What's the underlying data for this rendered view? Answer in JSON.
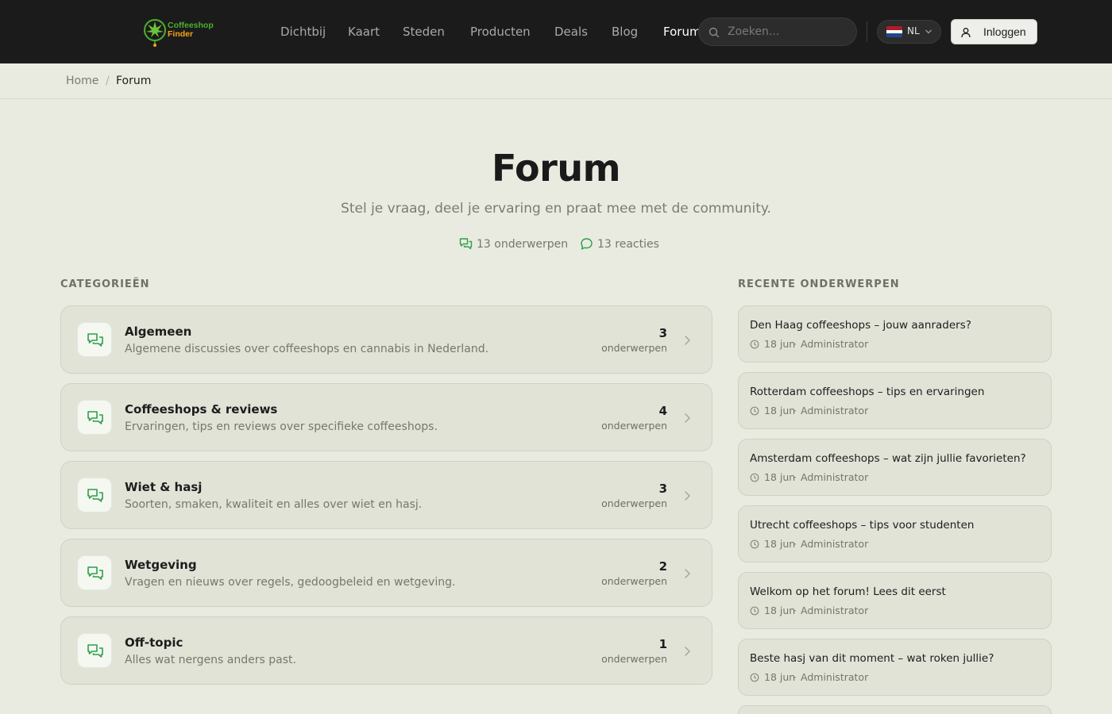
{
  "brand": {
    "line1": "Coffeeshop",
    "line2": "Finder"
  },
  "nav": [
    {
      "label": "Dichtbij",
      "active": false
    },
    {
      "label": "Kaart",
      "active": false
    },
    {
      "label": "Steden",
      "active": false
    },
    {
      "label": "Producten",
      "active": false
    },
    {
      "label": "Deals",
      "active": false
    },
    {
      "label": "Blog",
      "active": false
    },
    {
      "label": "Forum",
      "active": true
    }
  ],
  "search": {
    "placeholder": "Zoeken...",
    "icon": "search-icon"
  },
  "language": {
    "code": "NL",
    "flag": "netherlands-flag-icon"
  },
  "login": {
    "label": "Inloggen",
    "icon": "user-icon"
  },
  "breadcrumb": {
    "home": "Home",
    "separator": "/",
    "current": "Forum"
  },
  "hero": {
    "title": "Forum",
    "subtitle": "Stel je vraag, deel je ervaring en praat mee met de community.",
    "topics_stat": "13 onderwerpen",
    "replies_stat": "13 reacties"
  },
  "categories_label": "CATEGORIEËN",
  "recent_label": "RECENTE ONDERWERPEN",
  "categories": [
    {
      "title": "Algemeen",
      "description": "Algemene discussies over coffeeshops en cannabis in Nederland.",
      "count": "3",
      "count_label": "onderwerpen"
    },
    {
      "title": "Coffeeshops & reviews",
      "description": "Ervaringen, tips en reviews over specifieke coffeeshops.",
      "count": "4",
      "count_label": "onderwerpen"
    },
    {
      "title": "Wiet & hasj",
      "description": "Soorten, smaken, kwaliteit en alles over wiet en hasj.",
      "count": "3",
      "count_label": "onderwerpen"
    },
    {
      "title": "Wetgeving",
      "description": "Vragen en nieuws over regels, gedoogbeleid en wetgeving.",
      "count": "2",
      "count_label": "onderwerpen"
    },
    {
      "title": "Off-topic",
      "description": "Alles wat nergens anders past.",
      "count": "1",
      "count_label": "onderwerpen"
    }
  ],
  "recent_topics": [
    {
      "title": "Den Haag coffeeshops – jouw aanraders?",
      "date": "18 jun",
      "author": "Administrator"
    },
    {
      "title": "Rotterdam coffeeshops – tips en ervaringen",
      "date": "18 jun",
      "author": "Administrator"
    },
    {
      "title": "Amsterdam coffeeshops – wat zijn jullie favorieten?",
      "date": "18 jun",
      "author": "Administrator"
    },
    {
      "title": "Utrecht coffeeshops – tips voor studenten",
      "date": "18 jun",
      "author": "Administrator"
    },
    {
      "title": "Welkom op het forum! Lees dit eerst",
      "date": "18 jun",
      "author": "Administrator"
    },
    {
      "title": "Beste hasj van dit moment – wat roken jullie?",
      "date": "18 jun",
      "author": "Administrator"
    }
  ],
  "colors": {
    "accent_green": "#2e9e4a",
    "nav_bg": "#1b1b1b",
    "page_bg": "#e9ebe0",
    "logo_orange": "#f4a21a"
  }
}
